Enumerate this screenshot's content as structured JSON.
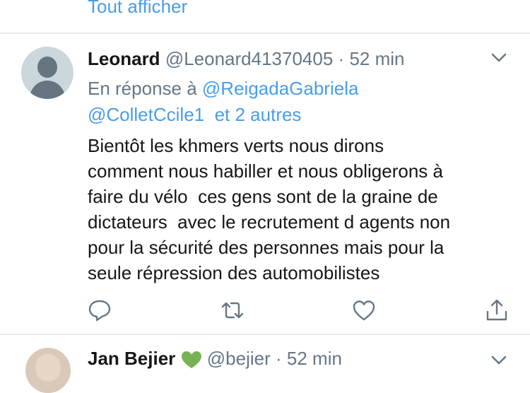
{
  "top": {
    "show_all_label": "Tout afficher"
  },
  "tweet": {
    "author_name": "Leonard",
    "author_handle": "@Leonard41370405",
    "separator": "·",
    "time": "52 min",
    "reply_prefix": "En réponse à",
    "reply_mention_1": "@ReigadaGabriela",
    "reply_mention_2": "@ColletCcile1",
    "reply_others": "et 2 autres",
    "text_lines": [
      "Bientôt les khmers verts nous dirons",
      "comment nous habiller et nous obligerons à",
      "faire du vélo  ces gens sont de la graine de",
      "dictateurs  avec le recrutement d agents non",
      "pour la sécurité des personnes mais pour la",
      "seule répression des automobilistes"
    ],
    "actions": {
      "reply": "reply-icon",
      "retweet": "retweet-icon",
      "like": "heart-icon",
      "share": "share-icon"
    }
  },
  "next_tweet": {
    "author_name": "Jan Bejier",
    "author_handle": "@bejier",
    "separator": "·",
    "time": "52 min",
    "badge_color": "#77b255"
  },
  "colors": {
    "link": "#4a9de6",
    "text": "#14171a",
    "secondary": "#657786",
    "divider": "#e6ecf0"
  }
}
